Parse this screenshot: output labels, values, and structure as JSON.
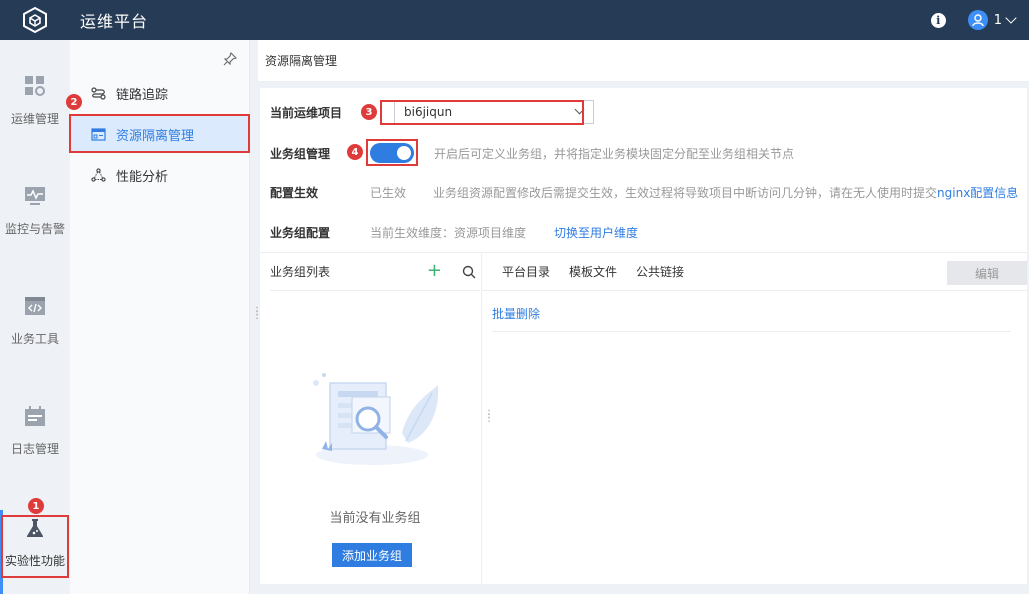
{
  "header": {
    "app_title": "运维平台",
    "user_name": "1"
  },
  "rail": {
    "items": [
      {
        "label": "运维管理",
        "icon": "grid-gear-icon"
      },
      {
        "label": "监控与告警",
        "icon": "monitor-pulse-icon"
      },
      {
        "label": "业务工具",
        "icon": "code-window-icon"
      },
      {
        "label": "日志管理",
        "icon": "calendar-log-icon"
      },
      {
        "label": "实验性功能",
        "icon": "flask-icon",
        "active": true
      }
    ]
  },
  "subnav": {
    "items": [
      {
        "label": "链路追踪",
        "icon": "trace-icon"
      },
      {
        "label": "资源隔离管理",
        "icon": "resource-isolation-icon",
        "active": true
      },
      {
        "label": "性能分析",
        "icon": "performance-icon"
      }
    ]
  },
  "page": {
    "title": "资源隔离管理",
    "current_project_label": "当前运维项目",
    "current_project_value": "bi6jiqun",
    "group_mgmt_label": "业务组管理",
    "group_mgmt_enabled": true,
    "group_mgmt_hint": "开启后可定义业务组，并将指定业务模块固定分配至业务组相关节点",
    "config_effective_label": "配置生效",
    "config_effective_status": "已生效",
    "config_effective_hint": "业务组资源配置修改后需提交生效，生效过程将导致项目中断访问几分钟，请在无人使用时提交",
    "config_effective_link": "nginx配置信息",
    "group_config_label": "业务组配置",
    "group_config_dimension": "当前生效维度：资源项目维度",
    "group_config_switch": "切换至用户维度"
  },
  "group_list": {
    "title": "业务组列表",
    "empty_text": "当前没有业务组",
    "add_button": "添加业务组"
  },
  "right_tabs": {
    "tabs": [
      "平台目录",
      "模板文件",
      "公共链接"
    ],
    "edit_button": "编辑",
    "batch_delete": "批量删除"
  },
  "annotations": {
    "badges": [
      "1",
      "2",
      "3",
      "4"
    ],
    "color": "#e03b3b"
  },
  "colors": {
    "topbar": "#263b55",
    "accent": "#2f7de1",
    "active_subnav_bg": "#dbeafd"
  }
}
